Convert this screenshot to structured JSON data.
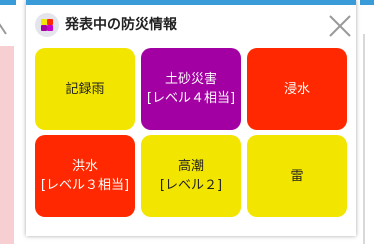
{
  "colors": {
    "accent_bar": "#3a9bd9",
    "yellow": "#f2e500",
    "purple": "#a300a3",
    "red": "#ff2800",
    "adjacent_pink": "#f7cfd3"
  },
  "panel": {
    "title": "発表中の防災情報",
    "app_icon": "four-color-squares-icon",
    "close_icon": "close-icon"
  },
  "tiles": [
    {
      "label": "記録雨",
      "color": "#f2e500",
      "text_color": "#222222"
    },
    {
      "label": "土砂災害\n[レベル４相当]",
      "color": "#a300a3",
      "text_color": "#ffffff"
    },
    {
      "label": "浸水",
      "color": "#ff2800",
      "text_color": "#ffffff"
    },
    {
      "label": "洪水\n[レベル３相当]",
      "color": "#ff2800",
      "text_color": "#ffffff"
    },
    {
      "label": "高潮\n[レベル２]",
      "color": "#f2e500",
      "text_color": "#222222"
    },
    {
      "label": "雷",
      "color": "#f2e500",
      "text_color": "#222222"
    }
  ]
}
